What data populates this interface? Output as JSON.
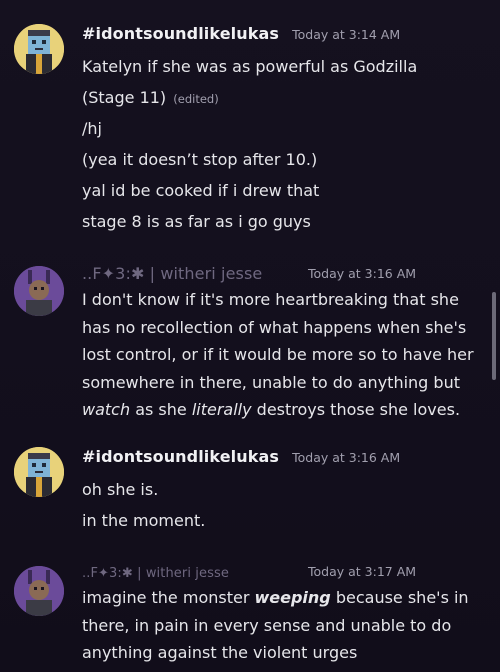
{
  "messages": [
    {
      "username": "#idontsoundlikelukas",
      "timestamp": "Today at 3:14 AM",
      "lines": [
        "Katelyn if she was as powerful as Godzilla",
        "(Stage 11)",
        "/hj",
        "(yea it doesn’t stop after 10.)",
        "yal id be cooked if i drew that",
        "stage 8 is as far as i go guys"
      ],
      "edited_label": "(edited)"
    },
    {
      "username": "..F✦3:✱ | witheri jesse",
      "timestamp": "Today at 3:16 AM",
      "text_parts": [
        "I don't know if it's more heartbreaking that she has no recollection of what happens when she's lost control, or if it would be more so to have her somewhere in there, unable to do anything but ",
        "watch",
        " as she ",
        "literally",
        " destroys those she loves."
      ]
    },
    {
      "username": "#idontsoundlikelukas",
      "timestamp": "Today at 3:16 AM",
      "lines": [
        "oh she is.",
        "in the moment."
      ]
    },
    {
      "username": "..F✦3:✱ | witheri jesse",
      "timestamp": "Today at 3:17 AM",
      "text_parts": [
        "imagine the monster ",
        "weeping",
        " because she's in there, in pain in every sense and unable to do anything against the violent urges"
      ]
    }
  ],
  "colors": {
    "background": "#14101e",
    "text": "#e6e6ea",
    "timestamp": "#a19fae",
    "avatar_yellow": "#e8d27a",
    "avatar_purple": "#6b4b9a"
  },
  "icons": {
    "avatar_1": "pixel-character-avatar",
    "avatar_2": "purple-character-avatar"
  }
}
